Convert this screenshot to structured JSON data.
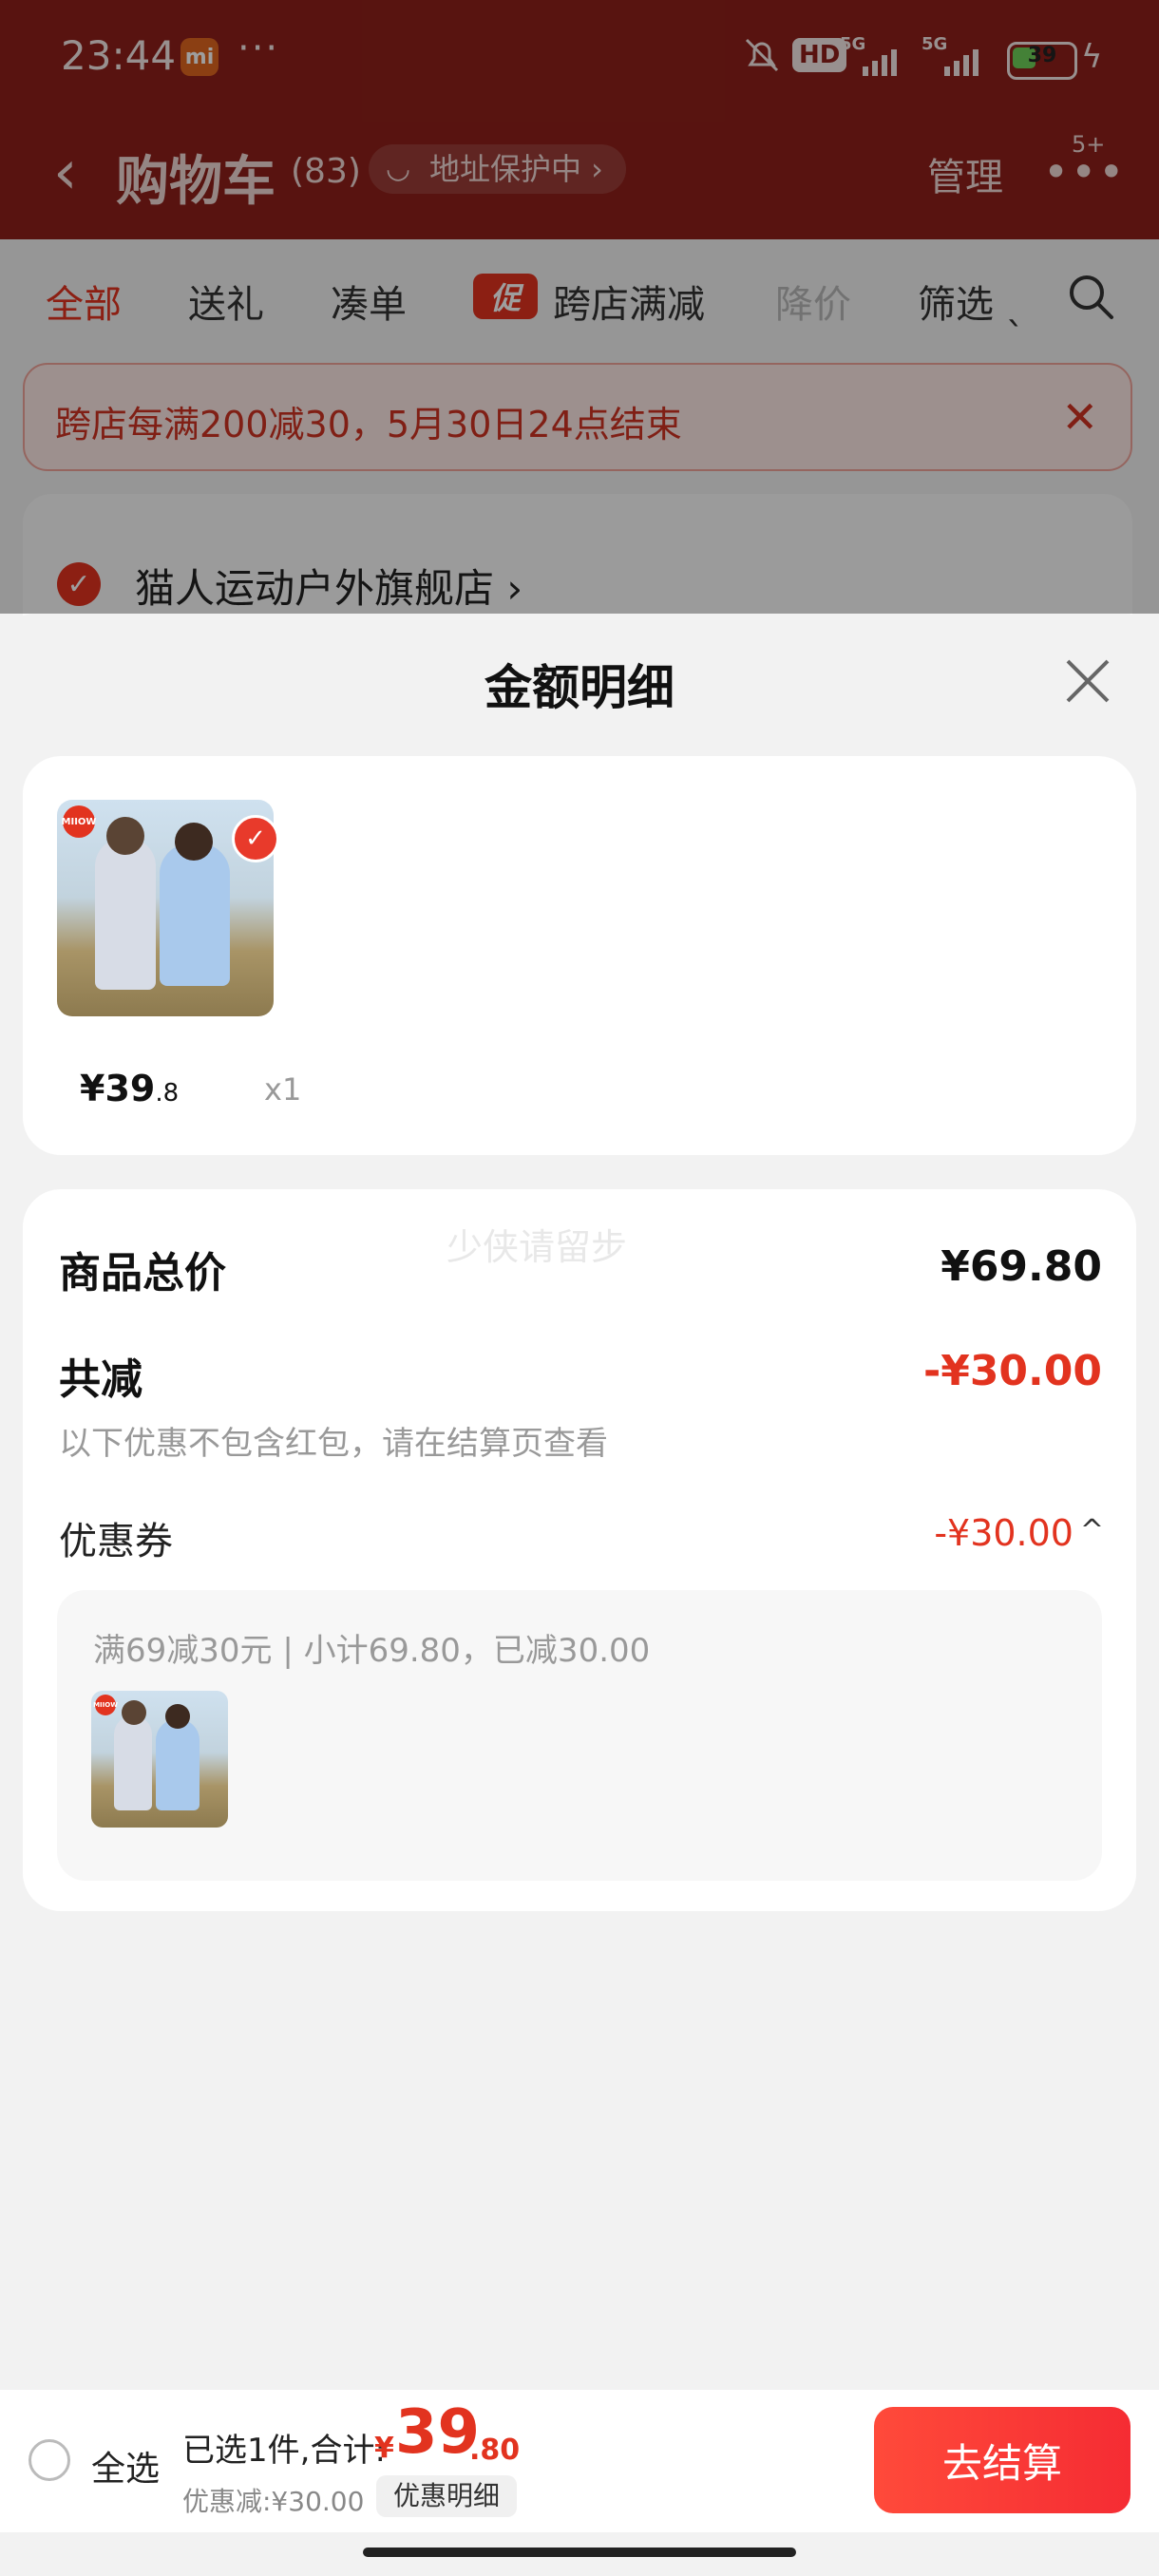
{
  "status_bar": {
    "time": "23:44",
    "app_badge": "mi",
    "dots": "···",
    "hd_label": "HD",
    "signal_1_label": "5G",
    "signal_2_label": "5G",
    "battery": "39",
    "battery_level_percent": 39
  },
  "header": {
    "back_icon": "chevron-left-icon",
    "title": "购物车",
    "count": "(83)",
    "address_protect": "地址保护中 ›",
    "manage": "管理",
    "more_icon": "more-dots-icon",
    "more_badge": "5+"
  },
  "filter_tabs": [
    "全部",
    "送礼",
    "凑单",
    "跨店满减",
    "降价",
    "筛选 ˎ"
  ],
  "promo_tag": "促",
  "promo_banner": {
    "text": "跨店每满200减30，5月30日24点结束",
    "close": "✕"
  },
  "store": {
    "name": "猫人运动户外旗舰店 ›"
  },
  "sheet": {
    "title": "金额明细",
    "item": {
      "price_int": "¥39",
      "price_dec": ".8",
      "qty": "x1",
      "brand_text": "MIIOW"
    },
    "watermark": "少侠请留步",
    "total_label": "商品总价",
    "total_value": "¥69.80",
    "reduce_label": "共减",
    "reduce_value": "-¥30.00",
    "reduce_note": "以下优惠不包含红包，请在结算页查看",
    "coupon_label": "优惠券",
    "coupon_value": "-¥30.00",
    "coupon_chevron": "^",
    "coupon_desc": "满69减30元 | 小计69.80，已减30.00"
  },
  "checkout": {
    "select_all": "全选",
    "summary": "已选1件,合计:",
    "currency": "¥",
    "total_int": "39",
    "total_dec": ".80",
    "discount": "优惠减:¥30.00",
    "detail_button": "优惠明细",
    "checkout_button": "去结算"
  },
  "colors": {
    "accent": "#e2331f",
    "header_bg": "#8e201a",
    "checkout_button": "#f52c33"
  }
}
